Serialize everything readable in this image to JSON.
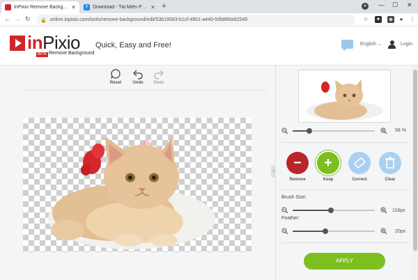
{
  "browser": {
    "tabs": [
      {
        "title": "InPixio Remove Background",
        "active": true,
        "favicon_color": "#d0262b"
      },
      {
        "title": "Download - Tải Miễn Phí VN - Ph",
        "active": false,
        "favicon_color": "#1e88e5",
        "favicon_letter": "T"
      }
    ],
    "url": "online.inpixio.com/tools/remove-background/edit/53b19583-b1cf-4901-a440-50b889a92549"
  },
  "header": {
    "logo_prefix": "in",
    "logo_name": "Pixio",
    "logo_badge": "BETA",
    "logo_sub": "Remove Background",
    "tagline": "Quick, Easy and Free!",
    "language": "English",
    "login": "Login"
  },
  "tools": {
    "reset": "Reset",
    "undo": "Undo",
    "redo": "Redo"
  },
  "panel": {
    "zoom_value": "58",
    "zoom_unit": "%",
    "zoom_level": 0.2,
    "actions": [
      {
        "label": "Remove",
        "color": "#b8262b",
        "glyph": "−"
      },
      {
        "label": "Keep",
        "color": "#7cbf1f",
        "glyph": "+"
      },
      {
        "label": "Correct",
        "color": "#a9d0f0",
        "glyph": "eraser"
      },
      {
        "label": "Clear",
        "color": "#a9d0f0",
        "glyph": "trash"
      }
    ],
    "brush_label": "Brush Size:",
    "brush_value": "118px",
    "brush_level": 0.47,
    "feather_label": "Feather:",
    "feather_value": "20px",
    "feather_level": 0.4,
    "apply": "APPLY"
  },
  "colors": {
    "brand_red": "#d0262b",
    "keep_green": "#7cbf1f",
    "accent_blue": "#a9d0f0"
  }
}
